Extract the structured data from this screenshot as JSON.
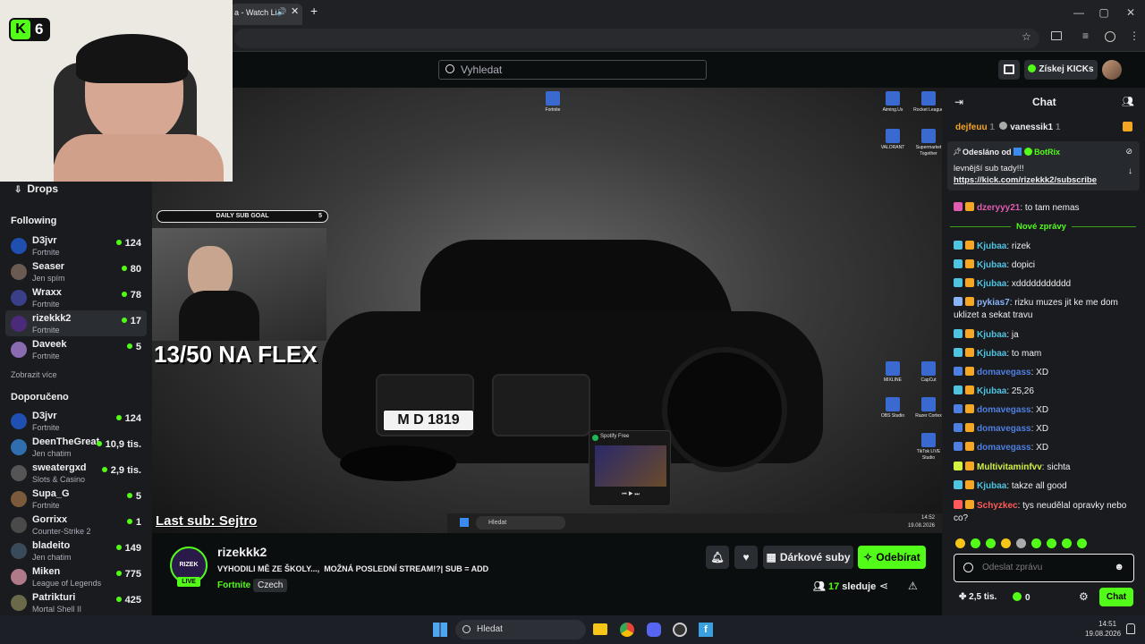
{
  "browser": {
    "tab_title": "a - Watch Li",
    "new_tab": "+"
  },
  "overlay_logo": {
    "text": "K",
    "number": "6"
  },
  "header": {
    "search_placeholder": "Vyhledat",
    "get_kicks": "Získej KICKs"
  },
  "sidebar": {
    "drops": "Drops",
    "following_title": "Following",
    "following": [
      {
        "name": "D3jvr",
        "game": "Fortnite",
        "viewers": "124",
        "color": "#1f4fb0"
      },
      {
        "name": "Seaser",
        "game": "Jen spím",
        "viewers": "80",
        "color": "#6a5a52"
      },
      {
        "name": "Wraxx",
        "game": "Fortnite",
        "viewers": "78",
        "color": "#3a3f8a"
      },
      {
        "name": "rizekkk2",
        "game": "Fortnite",
        "viewers": "17",
        "color": "#4b2a7a"
      },
      {
        "name": "Daveek",
        "game": "Fortnite",
        "viewers": "5",
        "color": "#8a6ab0"
      }
    ],
    "show_more": "Zobrazit více",
    "recommended_title": "Doporučeno",
    "recommended": [
      {
        "name": "D3jvr",
        "game": "Fortnite",
        "viewers": "124",
        "color": "#1f4fb0"
      },
      {
        "name": "DeenTheGreat",
        "game": "Jen chatim",
        "viewers": "10,9 tis.",
        "color": "#2f6fb0"
      },
      {
        "name": "sweatergxd",
        "game": "Slots & Casino",
        "viewers": "2,9 tis.",
        "color": "#555555"
      },
      {
        "name": "Supa_G",
        "game": "Fortnite",
        "viewers": "5",
        "color": "#7a5a3a"
      },
      {
        "name": "Gorrixx",
        "game": "Counter-Strike 2",
        "viewers": "1",
        "color": "#4a4a4a"
      },
      {
        "name": "bladeito",
        "game": "Jen chatim",
        "viewers": "149",
        "color": "#3a4a5a"
      },
      {
        "name": "Miken",
        "game": "League of Legends",
        "viewers": "775",
        "color": "#b07a8a"
      },
      {
        "name": "Patrikturi",
        "game": "Mortal Shell II",
        "viewers": "425",
        "color": "#6a6a4a"
      }
    ]
  },
  "video": {
    "sub_goal_label": "DAILY SUB GOAL",
    "sub_goal_value": "5",
    "flex_text": "13/50 NA FLEX",
    "plate": "M D 1819",
    "last_sub": "Last sub: Sejtro",
    "spotify_title": "Spotify Free",
    "desktop_icons": [
      "Fortnite",
      "Aiming.Us",
      "Rocket League",
      "VALORANT",
      "Supermarket Together",
      "MIXLINE",
      "CapCut",
      "OBS Studio",
      "Razer Cortex",
      "TikTok LIVE Studio"
    ],
    "inner_taskbar_search": "Hledat",
    "inner_time": "14:52",
    "inner_date": "19.08.2026"
  },
  "stream": {
    "channel": "rizekkk2",
    "avatar_text": "RIZEK",
    "live": "LIVE",
    "title": "VYHODILI MĚ ZE ŠKOLY...,  MOŽNÁ POSLEDNÍ STREAM!?| SUB = ADD",
    "category": "Fortnite",
    "tag": "Czech",
    "gift_subs": "Dárkové suby",
    "follow": "Odebírat",
    "viewers": "17",
    "viewers_label": "sleduje"
  },
  "chat": {
    "title": "Chat",
    "top_gifters": [
      {
        "name": "dejfeuu",
        "count": "1"
      },
      {
        "name": "vanessik1",
        "count": "1"
      }
    ],
    "pinned_from": "Odesláno od",
    "pinned_by": "BotRix",
    "pinned_text": "levnější sub tady!!!",
    "pinned_link": "https://kick.com/rizekkk2/subscribe",
    "new_messages": "Nové zprávy",
    "messages": [
      {
        "user": "dzeryyy21",
        "text": ": to tam nemas",
        "color": "#e05cb0"
      },
      {
        "user": "Kjubaa",
        "text": ": rizek",
        "color": "#4fc3e0"
      },
      {
        "user": "Kjubaa",
        "text": ": dopici",
        "color": "#4fc3e0"
      },
      {
        "user": "Kjubaa",
        "text": ": xddddddddddd",
        "color": "#4fc3e0"
      },
      {
        "user": "pykias7",
        "text": ": rizku muzes jit ke me dom uklizet a sekat travu",
        "color": "#8ab4f8"
      },
      {
        "user": "Kjubaa",
        "text": ": ja",
        "color": "#4fc3e0"
      },
      {
        "user": "Kjubaa",
        "text": ": to mam",
        "color": "#4fc3e0"
      },
      {
        "user": "domavegass",
        "text": ": XD",
        "color": "#4f7fe0"
      },
      {
        "user": "Kjubaa",
        "text": ": 25,26",
        "color": "#4fc3e0"
      },
      {
        "user": "domavegass",
        "text": ": XD",
        "color": "#4f7fe0"
      },
      {
        "user": "domavegass",
        "text": ": XD",
        "color": "#4f7fe0"
      },
      {
        "user": "domavegass",
        "text": ": XD",
        "color": "#4f7fe0"
      },
      {
        "user": "Multivitaminfvv",
        "text": ": sichta",
        "color": "#d4f040"
      },
      {
        "user": "Kjubaa",
        "text": ": takze all good",
        "color": "#4fc3e0"
      },
      {
        "user": "Schyzkec",
        "text": ": tys neudělal opravky nebo co?",
        "color": "#ff5a5a"
      }
    ],
    "input_placeholder": "Odeslat zprávu",
    "kicks_count": "2,5 tis.",
    "points": "0",
    "send": "Chat"
  },
  "os_taskbar": {
    "search": "Hledat",
    "time": "14:51",
    "date": "19.08.2026"
  },
  "colors": {
    "accent": "#53fc18",
    "bg": "#0b0e0f",
    "panel": "#191b1f"
  }
}
